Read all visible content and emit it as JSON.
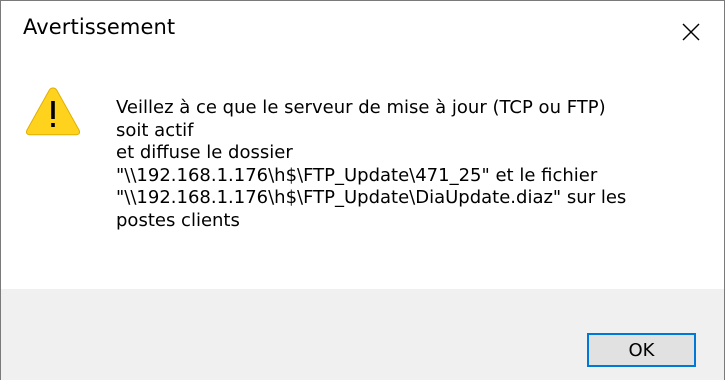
{
  "dialog": {
    "title": "Avertissement",
    "icon": "warning-icon",
    "message_lines": [
      "Veillez à ce que le serveur de mise à jour (TCP ou FTP)",
      "soit actif",
      "et diffuse le dossier",
      "\"\\\\192.168.1.176\\h$\\FTP_Update\\471_25\" et le fichier",
      "\"\\\\192.168.1.176\\h$\\FTP_Update\\DiaUpdate.diaz\" sur les",
      "postes clients"
    ],
    "ok_label": "OK",
    "close_icon": "close-icon"
  },
  "colors": {
    "warning_fill": "#ffd21e",
    "warning_glyph": "#000000",
    "focus_border": "#0078d7",
    "button_face": "#e1e1e1",
    "footer_bg": "#f0f0f0"
  }
}
